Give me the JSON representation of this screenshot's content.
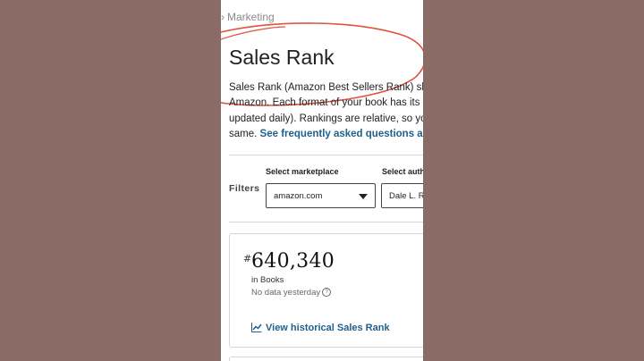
{
  "breadcrumb": {
    "separator": "›",
    "label": "Marketing"
  },
  "page": {
    "title": "Sales Rank",
    "description_lines": [
      "Sales Rank (Amazon Best Sellers Rank) sho",
      "Amazon. Each format of your book has its",
      "updated daily). Rankings are relative, so yo",
      "same."
    ],
    "faq_link": "See frequently asked questions abou"
  },
  "filters": {
    "label": "Filters",
    "marketplace": {
      "label": "Select marketplace",
      "value": "amazon.com"
    },
    "author": {
      "label": "Select auth",
      "value": "Dale L. R"
    }
  },
  "rank_card": {
    "hash": "#",
    "rank": "640,340",
    "category": "in Books",
    "no_data": "No data yesterday",
    "help_icon": "?",
    "history_link": "View historical Sales Rank"
  },
  "colors": {
    "background": "#8b6b66",
    "link": "#1f5f8b",
    "annotation": "#e0533d"
  }
}
